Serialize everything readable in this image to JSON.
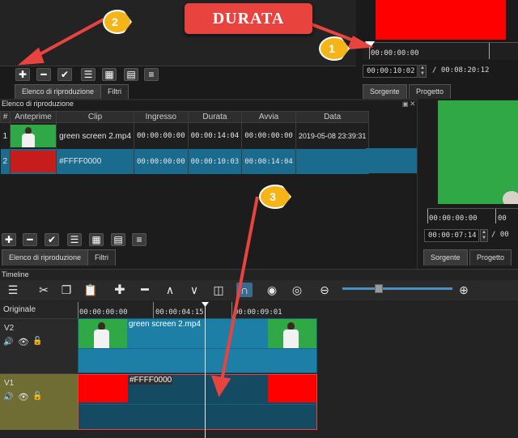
{
  "top": {
    "callout_label": "DURATA",
    "badges": [
      "1",
      "2",
      "3"
    ],
    "tabs": [
      "Elenco di riproduzione",
      "Filtri"
    ],
    "ruler_time": "00:00:00:00",
    "duration_value": "00:00:10:02",
    "total_time": "/ 00:08:20:12",
    "source_tab": "Sorgente",
    "project_tab": "Progetto",
    "preview_color": "#ff0000"
  },
  "playlist": {
    "title": "Elenco di riproduzione",
    "columns": [
      "#",
      "Anteprime",
      "Clip",
      "Ingresso",
      "Durata",
      "Avvia",
      "Data"
    ],
    "rows": [
      {
        "num": "1",
        "clip": "green screen 2.mp4",
        "in": "00:00:00:00",
        "duration": "00:00:14:04",
        "start": "00:00:00:00",
        "date": "2019-05-08 23:39:31"
      },
      {
        "num": "2",
        "clip": "#FFFF0000",
        "in": "00:00:00:00",
        "duration": "00:00:10:03",
        "start": "00:00:14:04",
        "date": ""
      }
    ],
    "tabs": [
      "Elenco di riproduzione",
      "Filtri"
    ]
  },
  "preview": {
    "ruler_time": "00:00:00:00",
    "ruler_time_right": "00",
    "position": "00:00:07:14",
    "total_short": "/ 00",
    "source_tab": "Sorgente",
    "project_tab": "Progetto",
    "screen_color": "#2fa845"
  },
  "timeline": {
    "title": "Timeline",
    "track_header": "Originale",
    "ruler_ticks": [
      "00:00:00:00",
      "00:00:04:15",
      "00:00:09:01"
    ],
    "tracks": [
      {
        "name": "V2",
        "clip_label": "green screen 2.mp4"
      },
      {
        "name": "V1",
        "clip_label": "#FFFF0000"
      }
    ],
    "zoom_level": 0.32
  },
  "colors": {
    "accent_red": "#e8433f",
    "badge_orange": "#f5b518",
    "selection_blue": "#1b6b8e",
    "clip_blue": "#1d7fa6",
    "track_v1_olive": "#6f6d33"
  }
}
